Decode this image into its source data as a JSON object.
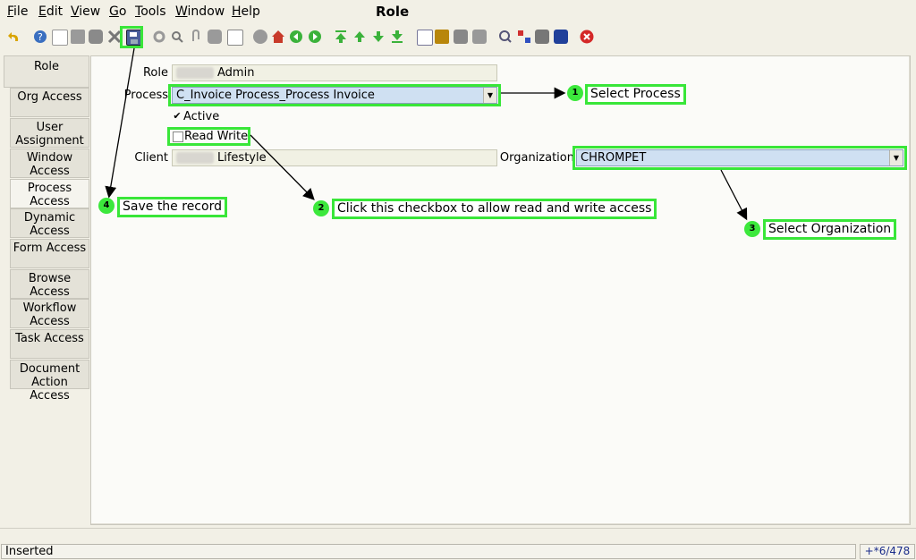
{
  "menu": [
    "File",
    "Edit",
    "View",
    "Go",
    "Tools",
    "Window",
    "Help"
  ],
  "window_title": "Role",
  "tabs": [
    {
      "label": "Role"
    },
    {
      "label": "Org Access"
    },
    {
      "label": "User Assignment"
    },
    {
      "label": "Window Access"
    },
    {
      "label": "Process Access"
    },
    {
      "label": "Dynamic Access"
    },
    {
      "label": "Form Access"
    },
    {
      "label": "Browse Access"
    },
    {
      "label": "Workflow Access"
    },
    {
      "label": "Task Access"
    },
    {
      "label": "Document Action Access"
    }
  ],
  "form": {
    "role_label": "Role",
    "role_value": "Admin",
    "process_label": "Process",
    "process_value": "C_Invoice Process_Process Invoice",
    "active_label": "Active",
    "read_write_label": "Read Write",
    "client_label": "Client",
    "client_value": "Lifestyle",
    "org_label": "Organization",
    "org_value": "CHROMPET"
  },
  "annotations": {
    "a1": {
      "num": "1",
      "text": "Select Process"
    },
    "a2": {
      "num": "2",
      "text": "Click this checkbox to allow read and write access"
    },
    "a3": {
      "num": "3",
      "text": "Select Organization"
    },
    "a4": {
      "num": "4",
      "text": "Save the record"
    }
  },
  "status": {
    "text": "Inserted",
    "record_count": "+*6/478"
  },
  "colors": {
    "highlight": "#39e639",
    "select_bg": "#cfe0f2"
  }
}
